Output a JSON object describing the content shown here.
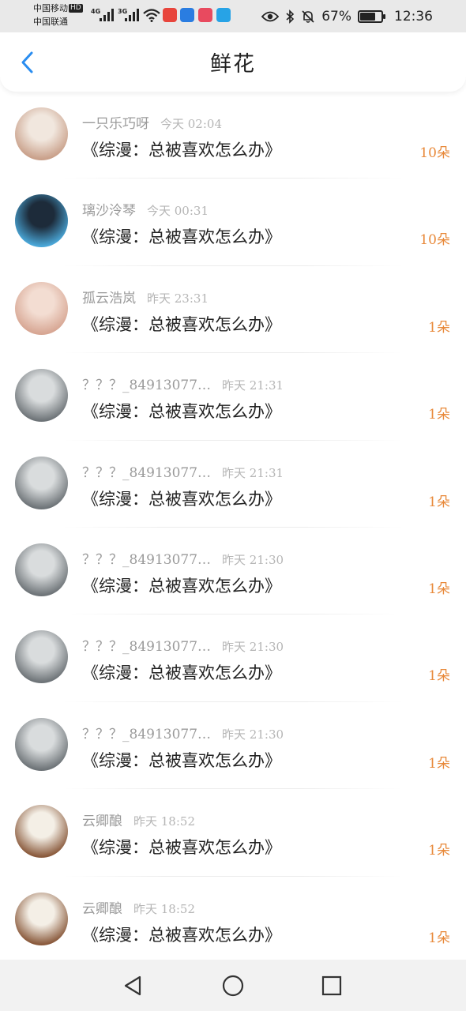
{
  "status_bar": {
    "carrier_1": "中国移动",
    "carrier_1_badge": "HD",
    "carrier_2": "中国联通",
    "net_1": "4G",
    "net_2": "3G",
    "battery_percent": "67%",
    "battery_level": 0.67,
    "time": "12:36",
    "app_icon_colors": [
      "#e8453c",
      "#2a7de1",
      "#e84a5f",
      "#27a3e6"
    ]
  },
  "header": {
    "title": "鲜花",
    "back_icon": "chevron-left-icon",
    "accent_color": "#2a8df0"
  },
  "list": {
    "items": [
      {
        "name": "一只乐巧呀",
        "time": "今天 02:04",
        "book": "《综漫：总被喜欢怎么办》",
        "count": "10朵",
        "avatar": {
          "colors": [
            "#c9a08a",
            "#f1e7de"
          ]
        }
      },
      {
        "name": "璃沙泠琴",
        "time": "今天 00:31",
        "book": "《综漫：总被喜欢怎么办》",
        "count": "10朵",
        "avatar": {
          "colors": [
            "#4aa7d8",
            "#1d2b3a"
          ]
        }
      },
      {
        "name": "孤云浩岚",
        "time": "昨天 23:31",
        "book": "《综漫：总被喜欢怎么办》",
        "count": "1朵",
        "avatar": {
          "colors": [
            "#d7a693",
            "#f3ddd2"
          ]
        }
      },
      {
        "name": "？？？_84913077…",
        "time": "昨天 21:31",
        "book": "《综漫：总被喜欢怎么办》",
        "count": "1朵",
        "avatar": {
          "colors": [
            "#6e7478",
            "#d9dcdd"
          ]
        }
      },
      {
        "name": "？？？_84913077…",
        "time": "昨天 21:31",
        "book": "《综漫：总被喜欢怎么办》",
        "count": "1朵",
        "avatar": {
          "colors": [
            "#6e7478",
            "#d9dcdd"
          ]
        }
      },
      {
        "name": "？？？_84913077…",
        "time": "昨天 21:30",
        "book": "《综漫：总被喜欢怎么办》",
        "count": "1朵",
        "avatar": {
          "colors": [
            "#6e7478",
            "#d9dcdd"
          ]
        }
      },
      {
        "name": "？？？_84913077…",
        "time": "昨天 21:30",
        "book": "《综漫：总被喜欢怎么办》",
        "count": "1朵",
        "avatar": {
          "colors": [
            "#6e7478",
            "#d9dcdd"
          ]
        }
      },
      {
        "name": "？？？_84913077…",
        "time": "昨天 21:30",
        "book": "《综漫：总被喜欢怎么办》",
        "count": "1朵",
        "avatar": {
          "colors": [
            "#6e7478",
            "#d9dcdd"
          ]
        }
      },
      {
        "name": "云卿酿",
        "time": "昨天 18:52",
        "book": "《综漫：总被喜欢怎么办》",
        "count": "1朵",
        "avatar": {
          "colors": [
            "#8a5a3c",
            "#f4efe6"
          ]
        }
      },
      {
        "name": "云卿酿",
        "time": "昨天 18:52",
        "book": "《综漫：总被喜欢怎么办》",
        "count": "1朵",
        "avatar": {
          "colors": [
            "#8a5a3c",
            "#f4efe6"
          ]
        }
      }
    ],
    "count_color": "#e8893a"
  },
  "system_nav": {
    "icons": [
      "back-triangle-icon",
      "home-circle-icon",
      "recents-square-icon"
    ]
  }
}
